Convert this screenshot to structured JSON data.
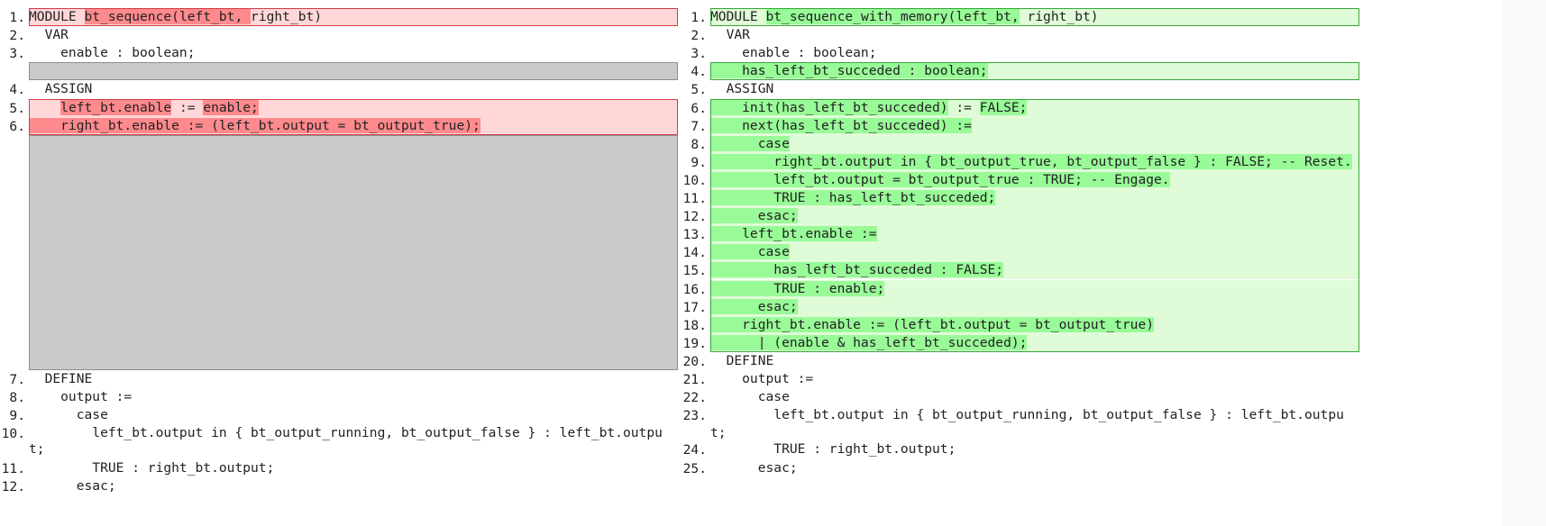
{
  "left": {
    "module_name": "bt_sequence",
    "lines": [
      {
        "n": "1.",
        "parts": [
          [
            "MODULE ",
            ""
          ],
          [
            "bt_sequence(left_bt, ",
            "hl"
          ],
          [
            "right_bt)",
            ""
          ]
        ],
        "kind": "del"
      },
      {
        "n": "2.",
        "parts": [
          [
            "  VAR",
            ""
          ]
        ],
        "kind": "ctx"
      },
      {
        "n": "3.",
        "parts": [
          [
            "    enable : boolean;",
            ""
          ]
        ],
        "kind": "ctx"
      },
      {
        "n": "4.",
        "parts": [
          [
            "  ASSIGN",
            ""
          ]
        ],
        "kind": "ctx"
      },
      {
        "n": "5.",
        "parts": [
          [
            "    ",
            ""
          ],
          [
            "left_bt.enable",
            "hl"
          ],
          [
            " := ",
            ""
          ],
          [
            "enable;",
            "hl"
          ]
        ],
        "kind": "del"
      },
      {
        "n": "6.",
        "parts": [
          [
            "    right_bt.enable := (left_bt.output = bt_output_true);",
            "hl"
          ]
        ],
        "kind": "del"
      },
      {
        "n": "7.",
        "parts": [
          [
            "  DEFINE",
            ""
          ]
        ],
        "kind": "ctx"
      },
      {
        "n": "8.",
        "parts": [
          [
            "    output :=",
            ""
          ]
        ],
        "kind": "ctx"
      },
      {
        "n": "9.",
        "parts": [
          [
            "      case",
            ""
          ]
        ],
        "kind": "ctx"
      },
      {
        "n": "10.",
        "parts": [
          [
            "        left_bt.output in { bt_output_running, bt_output_false } : left_bt.outpu",
            ""
          ]
        ],
        "kind": "ctx"
      },
      {
        "n": "",
        "parts": [
          [
            "t;",
            ""
          ]
        ],
        "kind": "ctx"
      },
      {
        "n": "11.",
        "parts": [
          [
            "        TRUE : right_bt.output;",
            ""
          ]
        ],
        "kind": "ctx"
      },
      {
        "n": "12.",
        "parts": [
          [
            "      esac;",
            ""
          ]
        ],
        "kind": "ctx"
      }
    ]
  },
  "right": {
    "module_name": "bt_sequence_with_memory",
    "lines": [
      {
        "n": "1.",
        "parts": [
          [
            "MODULE ",
            ""
          ],
          [
            "bt_sequence_with_memory(left_bt,",
            "hl"
          ],
          [
            " right_bt)",
            ""
          ]
        ],
        "kind": "add"
      },
      {
        "n": "2.",
        "parts": [
          [
            "  VAR",
            ""
          ]
        ],
        "kind": "ctx"
      },
      {
        "n": "3.",
        "parts": [
          [
            "    enable : boolean;",
            ""
          ]
        ],
        "kind": "ctx"
      },
      {
        "n": "4.",
        "parts": [
          [
            "    has_left_bt_succeded : boolean;",
            "hl"
          ]
        ],
        "kind": "add"
      },
      {
        "n": "5.",
        "parts": [
          [
            "  ASSIGN",
            ""
          ]
        ],
        "kind": "ctx"
      },
      {
        "n": "6.",
        "parts": [
          [
            "    init(has_left_bt_succeded)",
            "hl"
          ],
          [
            " := ",
            ""
          ],
          [
            "FALSE;",
            "hl"
          ]
        ],
        "kind": "add"
      },
      {
        "n": "7.",
        "parts": [
          [
            "    next(has_left_bt_succeded) :=",
            "hl"
          ]
        ],
        "kind": "add"
      },
      {
        "n": "8.",
        "parts": [
          [
            "      case",
            "hl"
          ]
        ],
        "kind": "add"
      },
      {
        "n": "9.",
        "parts": [
          [
            "        right_bt.output in { bt_output_true, bt_output_false } : FALSE; -- Reset.",
            "hl"
          ]
        ],
        "kind": "add"
      },
      {
        "n": "10.",
        "parts": [
          [
            "        left_bt.output = bt_output_true : TRUE; -- Engage.",
            "hl"
          ]
        ],
        "kind": "add"
      },
      {
        "n": "11.",
        "parts": [
          [
            "        TRUE : has_left_bt_succeded;",
            "hl"
          ]
        ],
        "kind": "add"
      },
      {
        "n": "12.",
        "parts": [
          [
            "      esac;",
            "hl"
          ]
        ],
        "kind": "add"
      },
      {
        "n": "13.",
        "parts": [
          [
            "    left_bt.enable :=",
            "hl"
          ]
        ],
        "kind": "add"
      },
      {
        "n": "14.",
        "parts": [
          [
            "      case",
            "hl"
          ]
        ],
        "kind": "add"
      },
      {
        "n": "15.",
        "parts": [
          [
            "        has_left_bt_succeded : FALSE;",
            "hl"
          ]
        ],
        "kind": "add"
      },
      {
        "n": "16.",
        "parts": [
          [
            "        TRUE : enable;",
            "hl"
          ]
        ],
        "kind": "add"
      },
      {
        "n": "17.",
        "parts": [
          [
            "      esac;",
            "hl"
          ]
        ],
        "kind": "add"
      },
      {
        "n": "18.",
        "parts": [
          [
            "    right_bt.enable := (left_bt.output = bt_output_true)",
            "hl"
          ]
        ],
        "kind": "add"
      },
      {
        "n": "19.",
        "parts": [
          [
            "      | (enable & has_left_bt_succeded);",
            "hl"
          ]
        ],
        "kind": "add"
      },
      {
        "n": "20.",
        "parts": [
          [
            "  DEFINE",
            ""
          ]
        ],
        "kind": "ctx"
      },
      {
        "n": "21.",
        "parts": [
          [
            "    output :=",
            ""
          ]
        ],
        "kind": "ctx"
      },
      {
        "n": "22.",
        "parts": [
          [
            "      case",
            ""
          ]
        ],
        "kind": "ctx"
      },
      {
        "n": "23.",
        "parts": [
          [
            "        left_bt.output in { bt_output_running, bt_output_false } : left_bt.outpu",
            ""
          ]
        ],
        "kind": "ctx"
      },
      {
        "n": "",
        "parts": [
          [
            "t;",
            ""
          ]
        ],
        "kind": "ctx"
      },
      {
        "n": "24.",
        "parts": [
          [
            "        TRUE : right_bt.output;",
            ""
          ]
        ],
        "kind": "ctx"
      },
      {
        "n": "25.",
        "parts": [
          [
            "      esac;",
            ""
          ]
        ],
        "kind": "ctx"
      }
    ]
  },
  "colors": {
    "deleted_line_bg": "#ffd7d9",
    "deleted_token_bg": "#ff8a8e",
    "added_line_bg": "#e0fbd8",
    "added_token_bg": "#99fa98",
    "placeholder_bg": "#cacaca"
  }
}
